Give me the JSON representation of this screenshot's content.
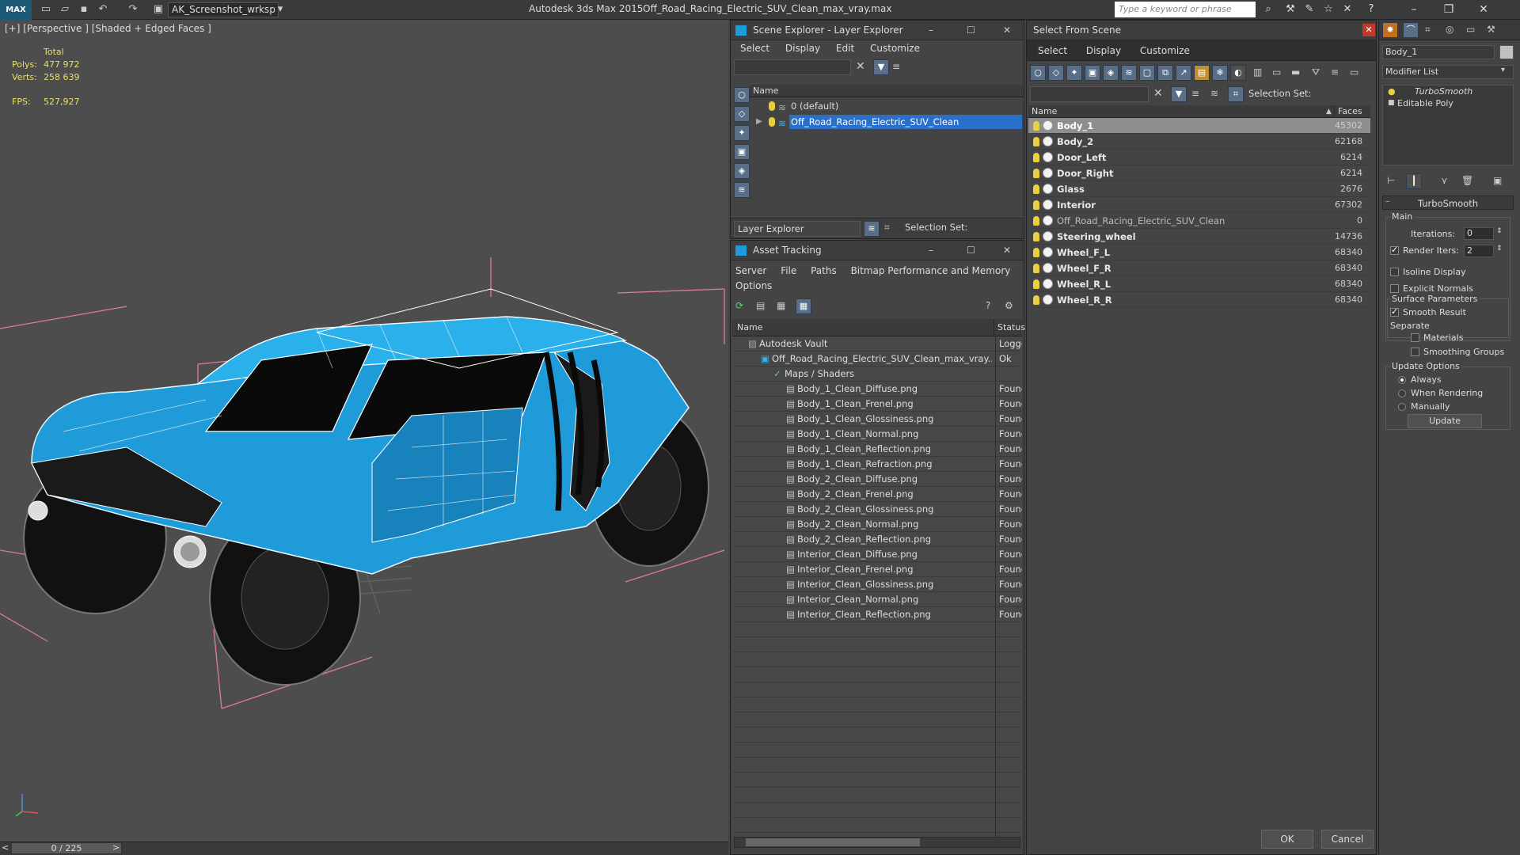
{
  "app": {
    "logo_text": "MAX",
    "workspace": "AK_Screenshot_wrksp",
    "title": "Autodesk 3ds Max  2015",
    "filename": "Off_Road_Racing_Electric_SUV_Clean_max_vray.max",
    "search_placeholder": "Type a keyword or phrase"
  },
  "viewport": {
    "label": "[+] [Perspective ] [Shaded + Edged Faces ]",
    "stats": {
      "total_label": "Total",
      "polys_label": "Polys:",
      "polys_value": "477 972",
      "verts_label": "Verts:",
      "verts_value": "258 639",
      "fps_label": "FPS:",
      "fps_value": "527,927"
    },
    "time_slider": "0 / 225"
  },
  "scene_explorer": {
    "title": "Scene Explorer - Layer Explorer",
    "menu": [
      "Select",
      "Display",
      "Edit",
      "Customize"
    ],
    "column_name": "Name",
    "layers": [
      {
        "name": "0 (default)",
        "selected": false
      },
      {
        "name": "Off_Road_Racing_Electric_SUV_Clean",
        "selected": true
      }
    ],
    "footer_dropdown": "Layer Explorer",
    "selection_set_label": "Selection Set:"
  },
  "asset_tracking": {
    "title": "Asset Tracking",
    "menu": [
      "Server",
      "File",
      "Paths",
      "Bitmap Performance and Memory",
      "Options"
    ],
    "col_name": "Name",
    "col_status": "Status",
    "rows": [
      {
        "name": "Autodesk Vault",
        "status": "Logged",
        "indent": 0
      },
      {
        "name": "Off_Road_Racing_Electric_SUV_Clean_max_vray....",
        "status": "Ok",
        "indent": 1
      },
      {
        "name": "Maps / Shaders",
        "status": "",
        "indent": 2
      },
      {
        "name": "Body_1_Clean_Diffuse.png",
        "status": "Found",
        "indent": 3
      },
      {
        "name": "Body_1_Clean_Frenel.png",
        "status": "Found",
        "indent": 3
      },
      {
        "name": "Body_1_Clean_Glossiness.png",
        "status": "Found",
        "indent": 3
      },
      {
        "name": "Body_1_Clean_Normal.png",
        "status": "Found",
        "indent": 3
      },
      {
        "name": "Body_1_Clean_Reflection.png",
        "status": "Found",
        "indent": 3
      },
      {
        "name": "Body_1_Clean_Refraction.png",
        "status": "Found",
        "indent": 3
      },
      {
        "name": "Body_2_Clean_Diffuse.png",
        "status": "Found",
        "indent": 3
      },
      {
        "name": "Body_2_Clean_Frenel.png",
        "status": "Found",
        "indent": 3
      },
      {
        "name": "Body_2_Clean_Glossiness.png",
        "status": "Found",
        "indent": 3
      },
      {
        "name": "Body_2_Clean_Normal.png",
        "status": "Found",
        "indent": 3
      },
      {
        "name": "Body_2_Clean_Reflection.png",
        "status": "Found",
        "indent": 3
      },
      {
        "name": "Interior_Clean_Diffuse.png",
        "status": "Found",
        "indent": 3
      },
      {
        "name": "Interior_Clean_Frenel.png",
        "status": "Found",
        "indent": 3
      },
      {
        "name": "Interior_Clean_Glossiness.png",
        "status": "Found",
        "indent": 3
      },
      {
        "name": "Interior_Clean_Normal.png",
        "status": "Found",
        "indent": 3
      },
      {
        "name": "Interior_Clean_Reflection.png",
        "status": "Found",
        "indent": 3
      }
    ]
  },
  "select_from_scene": {
    "title": "Select From Scene",
    "menu": [
      "Select",
      "Display",
      "Customize"
    ],
    "selection_set_label": "Selection Set:",
    "col_name": "Name",
    "col_faces": "Faces",
    "objects": [
      {
        "name": "Body_1",
        "faces": "45302",
        "selected": true
      },
      {
        "name": "Body_2",
        "faces": "62168",
        "selected": false
      },
      {
        "name": "Door_Left",
        "faces": "6214",
        "selected": false
      },
      {
        "name": "Door_Right",
        "faces": "6214",
        "selected": false
      },
      {
        "name": "Glass",
        "faces": "2676",
        "selected": false
      },
      {
        "name": "Interior",
        "faces": "67302",
        "selected": false
      },
      {
        "name": "Off_Road_Racing_Electric_SUV_Clean",
        "faces": "0",
        "selected": false
      },
      {
        "name": "Steering_wheel",
        "faces": "14736",
        "selected": false
      },
      {
        "name": "Wheel_F_L",
        "faces": "68340",
        "selected": false
      },
      {
        "name": "Wheel_F_R",
        "faces": "68340",
        "selected": false
      },
      {
        "name": "Wheel_R_L",
        "faces": "68340",
        "selected": false
      },
      {
        "name": "Wheel_R_R",
        "faces": "68340",
        "selected": false
      }
    ],
    "ok_label": "OK",
    "cancel_label": "Cancel"
  },
  "command_panel": {
    "object_name": "Body_1",
    "modifier_list": "Modifier List",
    "stack": [
      "TurboSmooth",
      "Editable Poly"
    ],
    "rollout_title": "TurboSmooth",
    "main_label": "Main",
    "iterations_label": "Iterations:",
    "iterations_value": "0",
    "render_iters_label": "Render Iters:",
    "render_iters_value": "2",
    "isoline_label": "Isoline Display",
    "explicit_normals_label": "Explicit Normals",
    "surface_params_label": "Surface Parameters",
    "smooth_result_label": "Smooth Result",
    "separate_label": "Separate",
    "materials_label": "Materials",
    "smoothing_groups_label": "Smoothing Groups",
    "update_options_label": "Update Options",
    "always_label": "Always",
    "when_rendering_label": "When Rendering",
    "manually_label": "Manually",
    "update_button": "Update"
  },
  "colors": {
    "accent_blue": "#1e9bd8",
    "selection_blue": "#2a6fc9",
    "stats_yellow": "#e8e066",
    "bbox_pink": "#e07aa0"
  }
}
